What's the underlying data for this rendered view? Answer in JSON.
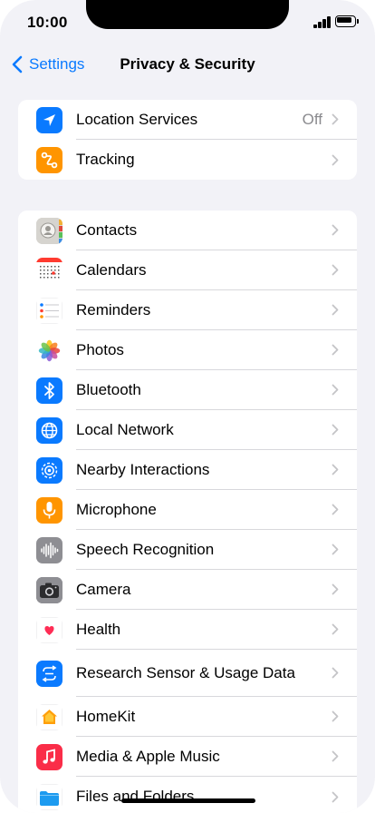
{
  "status_bar": {
    "time": "10:00"
  },
  "nav": {
    "back_label": "Settings",
    "title": "Privacy & Security",
    "accent_color": "#0a7aff"
  },
  "groups": [
    {
      "rows": [
        {
          "label": "Location Services",
          "value": "Off",
          "icon": "location-arrow-icon",
          "icon_bg": "#0a7aff"
        },
        {
          "label": "Tracking",
          "value": "",
          "icon": "tracking-icon",
          "icon_bg": "#ff9500"
        }
      ]
    },
    {
      "rows": [
        {
          "label": "Contacts",
          "icon": "contacts-icon",
          "icon_bg": "#d6d4cf"
        },
        {
          "label": "Calendars",
          "icon": "calendar-icon",
          "icon_bg": "#ffffff"
        },
        {
          "label": "Reminders",
          "icon": "reminders-icon",
          "icon_bg": "#ffffff"
        },
        {
          "label": "Photos",
          "icon": "photos-icon",
          "icon_bg": "#ffffff"
        },
        {
          "label": "Bluetooth",
          "icon": "bluetooth-icon",
          "icon_bg": "#0a7aff"
        },
        {
          "label": "Local Network",
          "icon": "globe-icon",
          "icon_bg": "#0a7aff"
        },
        {
          "label": "Nearby Interactions",
          "icon": "nearby-interactions-icon",
          "icon_bg": "#0a7aff"
        },
        {
          "label": "Microphone",
          "icon": "microphone-icon",
          "icon_bg": "#ff9500"
        },
        {
          "label": "Speech Recognition",
          "icon": "waveform-icon",
          "icon_bg": "#8e8e93"
        },
        {
          "label": "Camera",
          "icon": "camera-icon",
          "icon_bg": "#8e8e93"
        },
        {
          "label": "Health",
          "icon": "heart-icon",
          "icon_bg": "#ffffff"
        },
        {
          "label": "Research Sensor & Usage Data",
          "icon": "research-icon",
          "icon_bg": "#0a7aff"
        },
        {
          "label": "HomeKit",
          "icon": "home-icon",
          "icon_bg": "#ffffff"
        },
        {
          "label": "Media & Apple Music",
          "icon": "music-note-icon",
          "icon_bg": "#fa2d48"
        },
        {
          "label": "Files and Folders",
          "icon": "folder-icon",
          "icon_bg": "#ffffff"
        }
      ]
    }
  ]
}
